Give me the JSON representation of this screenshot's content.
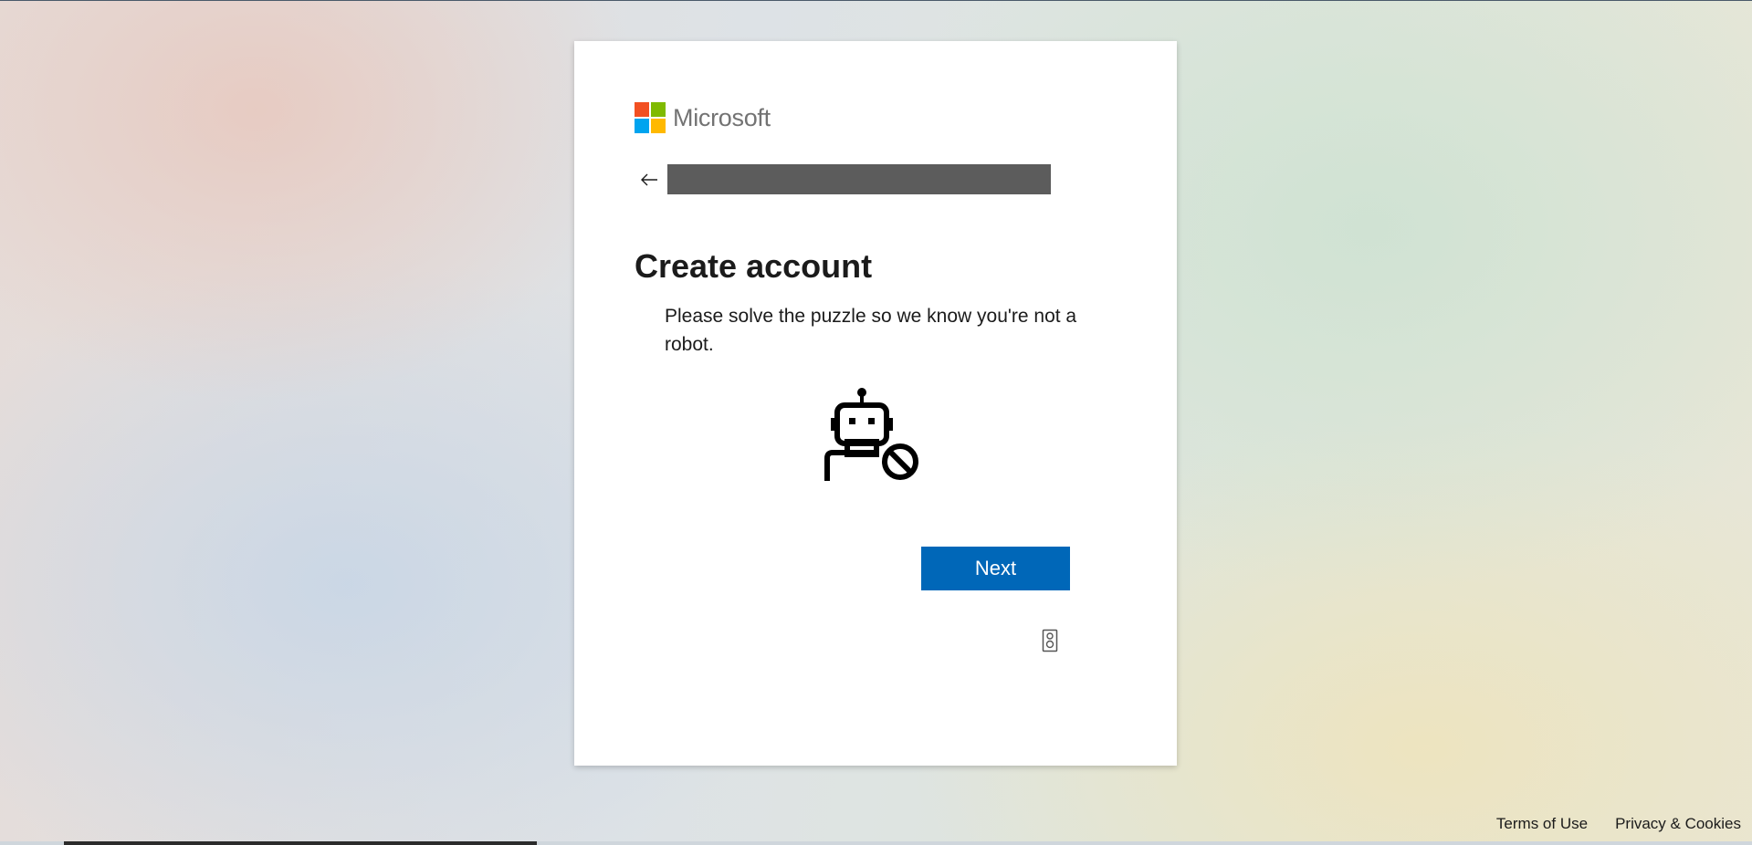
{
  "brand": {
    "name": "Microsoft",
    "logo_colors": [
      "#f25022",
      "#7fba00",
      "#00a4ef",
      "#ffb900"
    ]
  },
  "header": {
    "back_icon": "arrow-left-icon",
    "identity_text": ""
  },
  "main": {
    "title": "Create account",
    "description": "Please solve the puzzle so we know you're not a robot.",
    "illustration_icon": "robot-blocked-icon",
    "next_label": "Next",
    "help_icon": "speaker-icon"
  },
  "footer": {
    "links": [
      "Terms of Use",
      "Privacy & Cookies"
    ]
  },
  "colors": {
    "accent": "#0067b8",
    "text": "#1b1b1b",
    "redacted_bar": "#5c5c5c"
  }
}
